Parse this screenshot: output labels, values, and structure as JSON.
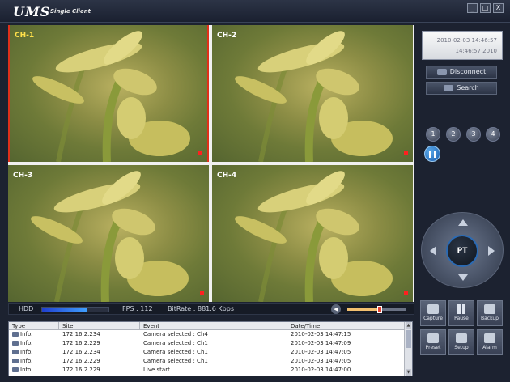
{
  "window": {
    "logo": "UMS",
    "subtitle": "Single Client",
    "buttons": {
      "minimize": "_",
      "maximize": "□",
      "close": "X"
    }
  },
  "channels": [
    {
      "label": "CH-1",
      "active": true
    },
    {
      "label": "CH-2",
      "active": false
    },
    {
      "label": "CH-3",
      "active": false
    },
    {
      "label": "CH-4",
      "active": false
    }
  ],
  "status": {
    "hdd_label": "HDD",
    "hdd_fill": 0.68,
    "fps": "FPS : 112",
    "bitrate": "BitRate : 881.6 Kbps",
    "volume": 0.55
  },
  "log": {
    "columns": [
      "Type",
      "Site",
      "Event",
      "Date/Time"
    ],
    "rows": [
      {
        "type": "Info.",
        "site": "172.16.2.234",
        "event": "Camera selected : Ch4",
        "datetime": "2010-02-03 14:47:15"
      },
      {
        "type": "Info.",
        "site": "172.16.2.229",
        "event": "Camera selected : Ch1",
        "datetime": "2010-02-03 14:47:09"
      },
      {
        "type": "Info.",
        "site": "172.16.2.234",
        "event": "Camera selected : Ch1",
        "datetime": "2010-02-03 14:47:05"
      },
      {
        "type": "Info.",
        "site": "172.16.2.229",
        "event": "Camera selected : Ch1",
        "datetime": "2010-02-03 14:47:05"
      },
      {
        "type": "Info.",
        "site": "172.16.2.229",
        "event": "Live start",
        "datetime": "2010-02-03 14:47:00"
      }
    ]
  },
  "panel": {
    "date": "2010-02-03 14:46:57",
    "time": "14:46:57 2010",
    "disconnect": "Disconnect",
    "search": "Search",
    "channel_buttons": [
      "1",
      "2",
      "3",
      "4"
    ],
    "ptz_center": "PT"
  },
  "tools": [
    {
      "label": "Capture",
      "icon": "capture-icon"
    },
    {
      "label": "Pause",
      "icon": "pause-icon"
    },
    {
      "label": "Backup",
      "icon": "backup-icon"
    },
    {
      "label": "Preset",
      "icon": "preset-icon"
    },
    {
      "label": "Setup",
      "icon": "setup-icon"
    },
    {
      "label": "Alarm",
      "icon": "alarm-icon"
    }
  ]
}
